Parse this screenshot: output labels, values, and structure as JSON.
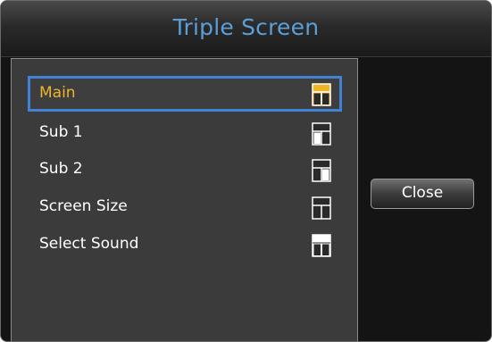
{
  "dialog": {
    "title": "Triple Screen"
  },
  "menu": {
    "items": [
      {
        "label": "Main",
        "selected": true,
        "icon": "layout-main-highlight-icon"
      },
      {
        "label": "Sub 1",
        "selected": false,
        "icon": "layout-sub1-highlight-icon"
      },
      {
        "label": "Sub 2",
        "selected": false,
        "icon": "layout-sub2-highlight-icon"
      },
      {
        "label": "Screen Size",
        "selected": false,
        "icon": "layout-screen-size-icon"
      },
      {
        "label": "Select Sound",
        "selected": false,
        "icon": "layout-select-sound-icon"
      }
    ]
  },
  "buttons": {
    "close_label": "Close"
  },
  "colors": {
    "title": "#5b9fd6",
    "selected_text": "#f0b429",
    "selection_border": "#3f82d6",
    "panel": "#3b3b3b",
    "background": "#141414"
  }
}
